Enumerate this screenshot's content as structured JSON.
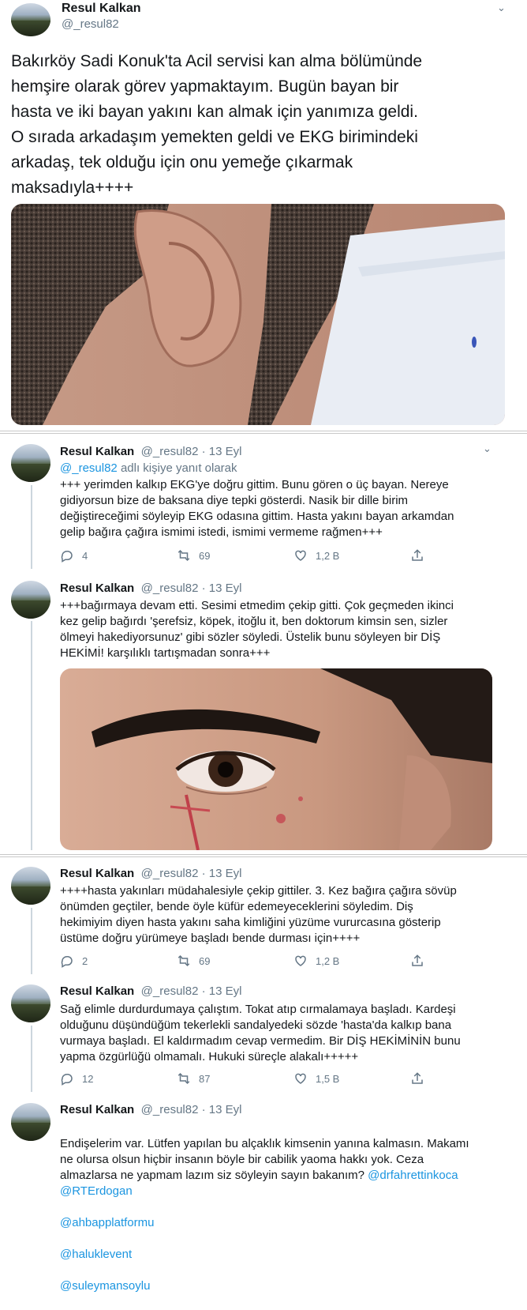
{
  "main_tweet": {
    "name": "Resul Kalkan",
    "handle": "@_resul82",
    "text": "Bakırköy Sadi Konuk'ta Acil servisi kan alma bölümünde\nhemşire olarak görev yapmaktayım. Bugün bayan bir\nhasta ve iki bayan yakını kan almak için yanımıza geldi.\nO sırada arkadaşım yemekten geldi ve EKG birimindeki\narkadaş, tek olduğu için onu yemeğe çıkarmak\nmaksadıyla++++"
  },
  "replies": [
    {
      "name": "Resul Kalkan",
      "meta": "@_resul82 · 13 Eyl",
      "reply_to_handle": "@_resul82",
      "reply_to_suffix": " adlı kişiye yanıt olarak",
      "text": "+++ yerimden kalkıp EKG'ye doğru gittim. Bunu gören o üç bayan. Nereye\ngidiyorsun bize de baksana diye tepki gösterdi. Nasik bir dille birim\ndeğiştireceğimi söyleyip EKG odasına gittim. Hasta yakını bayan arkamdan\ngelip bağıra çağıra ismimi istedi, ismimi vermeme rağmen+++",
      "replies": "4",
      "retweets": "69",
      "likes": "1,2 B"
    },
    {
      "name": "Resul Kalkan",
      "meta": "@_resul82 · 13 Eyl",
      "text": "+++bağırmaya devam etti. Sesimi etmedim çekip gitti. Çok geçmeden ikinci\nkez gelip bağırdı 'şerefsiz, köpek, itoğlu it,  ben doktorum kimsin sen, sizler\nölmeyi hakediyorsunuz' gibi sözler söyledi. Üstelik bunu söyleyen bir DİŞ\nHEKİMİ! karşılıklı tartışmadan sonra+++"
    },
    {
      "name": "Resul Kalkan",
      "meta": "@_resul82 · 13 Eyl",
      "text": "++++hasta yakınları müdahalesiyle çekip gittiler. 3. Kez bağıra çağıra sövüp\nönümden geçtiler, bende öyle küfür edemeyeceklerini söyledim. Diş\nhekimiyim diyen hasta yakını saha kimliğini yüzüme vururcasına gösterip\nüstüme doğru yürümeye başladı bende durması için++++",
      "replies": "2",
      "retweets": "69",
      "likes": "1,2 B"
    },
    {
      "name": "Resul Kalkan",
      "meta": "@_resul82 · 13 Eyl",
      "text": "Sağ elimle durdurdumaya çalıştım. Tokat atıp cırmalamaya başladı. Kardeşi\nolduğunu düşündüğüm tekerlekli sandalyedeki sözde 'hasta'da kalkıp bana\nvurmaya başladı. El kaldırmadım cevap vermedim. Bir DİŞ HEKİMİNİN bunu\nyapma özgürlüğü olmamalı. Hukuki süreçle alakalı+++++",
      "replies": "12",
      "retweets": "87",
      "likes": "1,5 B"
    },
    {
      "name": "Resul Kalkan",
      "meta": "@_resul82 · 13 Eyl",
      "text": "Endişelerim var. Lütfen yapılan bu alçaklık kimsenin yanına kalmasın. Makamı\nne olursa olsun hiçbir insanın böyle bir cabilik yaoma hakkı yok. Ceza\nalmazlarsa ne yapmam lazım siz söyleyin sayın bakanım? ",
      "mentions": [
        "@drfahrettinkoca",
        "@RTErdogan",
        "@ahbapplatformu",
        "@haluklevent",
        "@suleymansoylu"
      ]
    }
  ],
  "icons": {
    "reply": "reply-icon",
    "retweet": "retweet-icon",
    "like": "heart-icon",
    "share": "share-icon",
    "menu": "chevron-down-icon"
  },
  "colors": {
    "link": "#1b95e0",
    "secondary_text": "#657786"
  }
}
